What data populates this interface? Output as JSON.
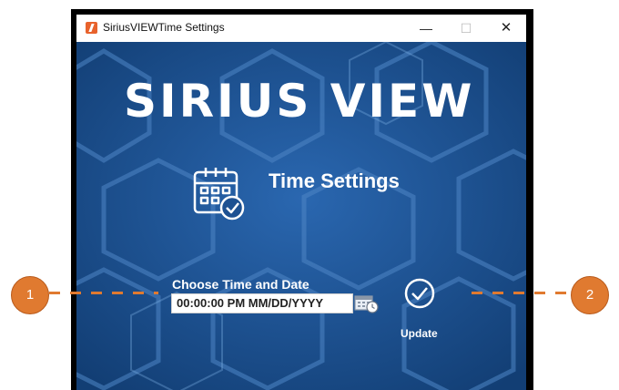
{
  "window": {
    "title": "SiriusVIEWTime Settings",
    "controls": {
      "minimize": "—",
      "maximize": "☐",
      "close": "✕"
    },
    "app_icon": "app-logo-icon"
  },
  "main": {
    "logo_text": "SIRIUS VIEW",
    "section_icon": "calendar-check-icon",
    "section_title": "Time Settings",
    "datetime_label": "Choose Time and Date",
    "datetime_value": "00:00:00 PM MM/DD/YYYY",
    "picker_icon": "calendar-clock-icon",
    "update_icon": "check-circle-icon",
    "update_label": "Update"
  },
  "callouts": [
    "1",
    "2"
  ],
  "colors": {
    "background": "#1b4f8f",
    "accent": "#e07a30",
    "text": "#ffffff"
  }
}
